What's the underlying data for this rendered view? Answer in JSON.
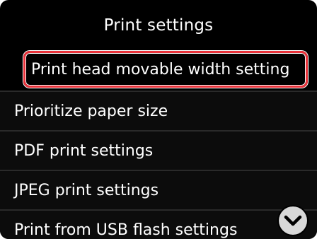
{
  "header": {
    "title": "Print settings"
  },
  "menu": {
    "items": [
      {
        "label": "Print head movable width setting",
        "selected": true
      },
      {
        "label": "Prioritize paper size",
        "selected": false
      },
      {
        "label": "PDF print settings",
        "selected": false
      },
      {
        "label": "JPEG print settings",
        "selected": false
      },
      {
        "label": "Print from USB flash settings",
        "selected": false
      }
    ]
  },
  "controls": {
    "scroll_down_icon": "chevron-down-icon"
  },
  "colors": {
    "background": "#000000",
    "text": "#ffffff",
    "selection_outline": "#e8323a",
    "scroll_button": "#d8d8d8"
  }
}
